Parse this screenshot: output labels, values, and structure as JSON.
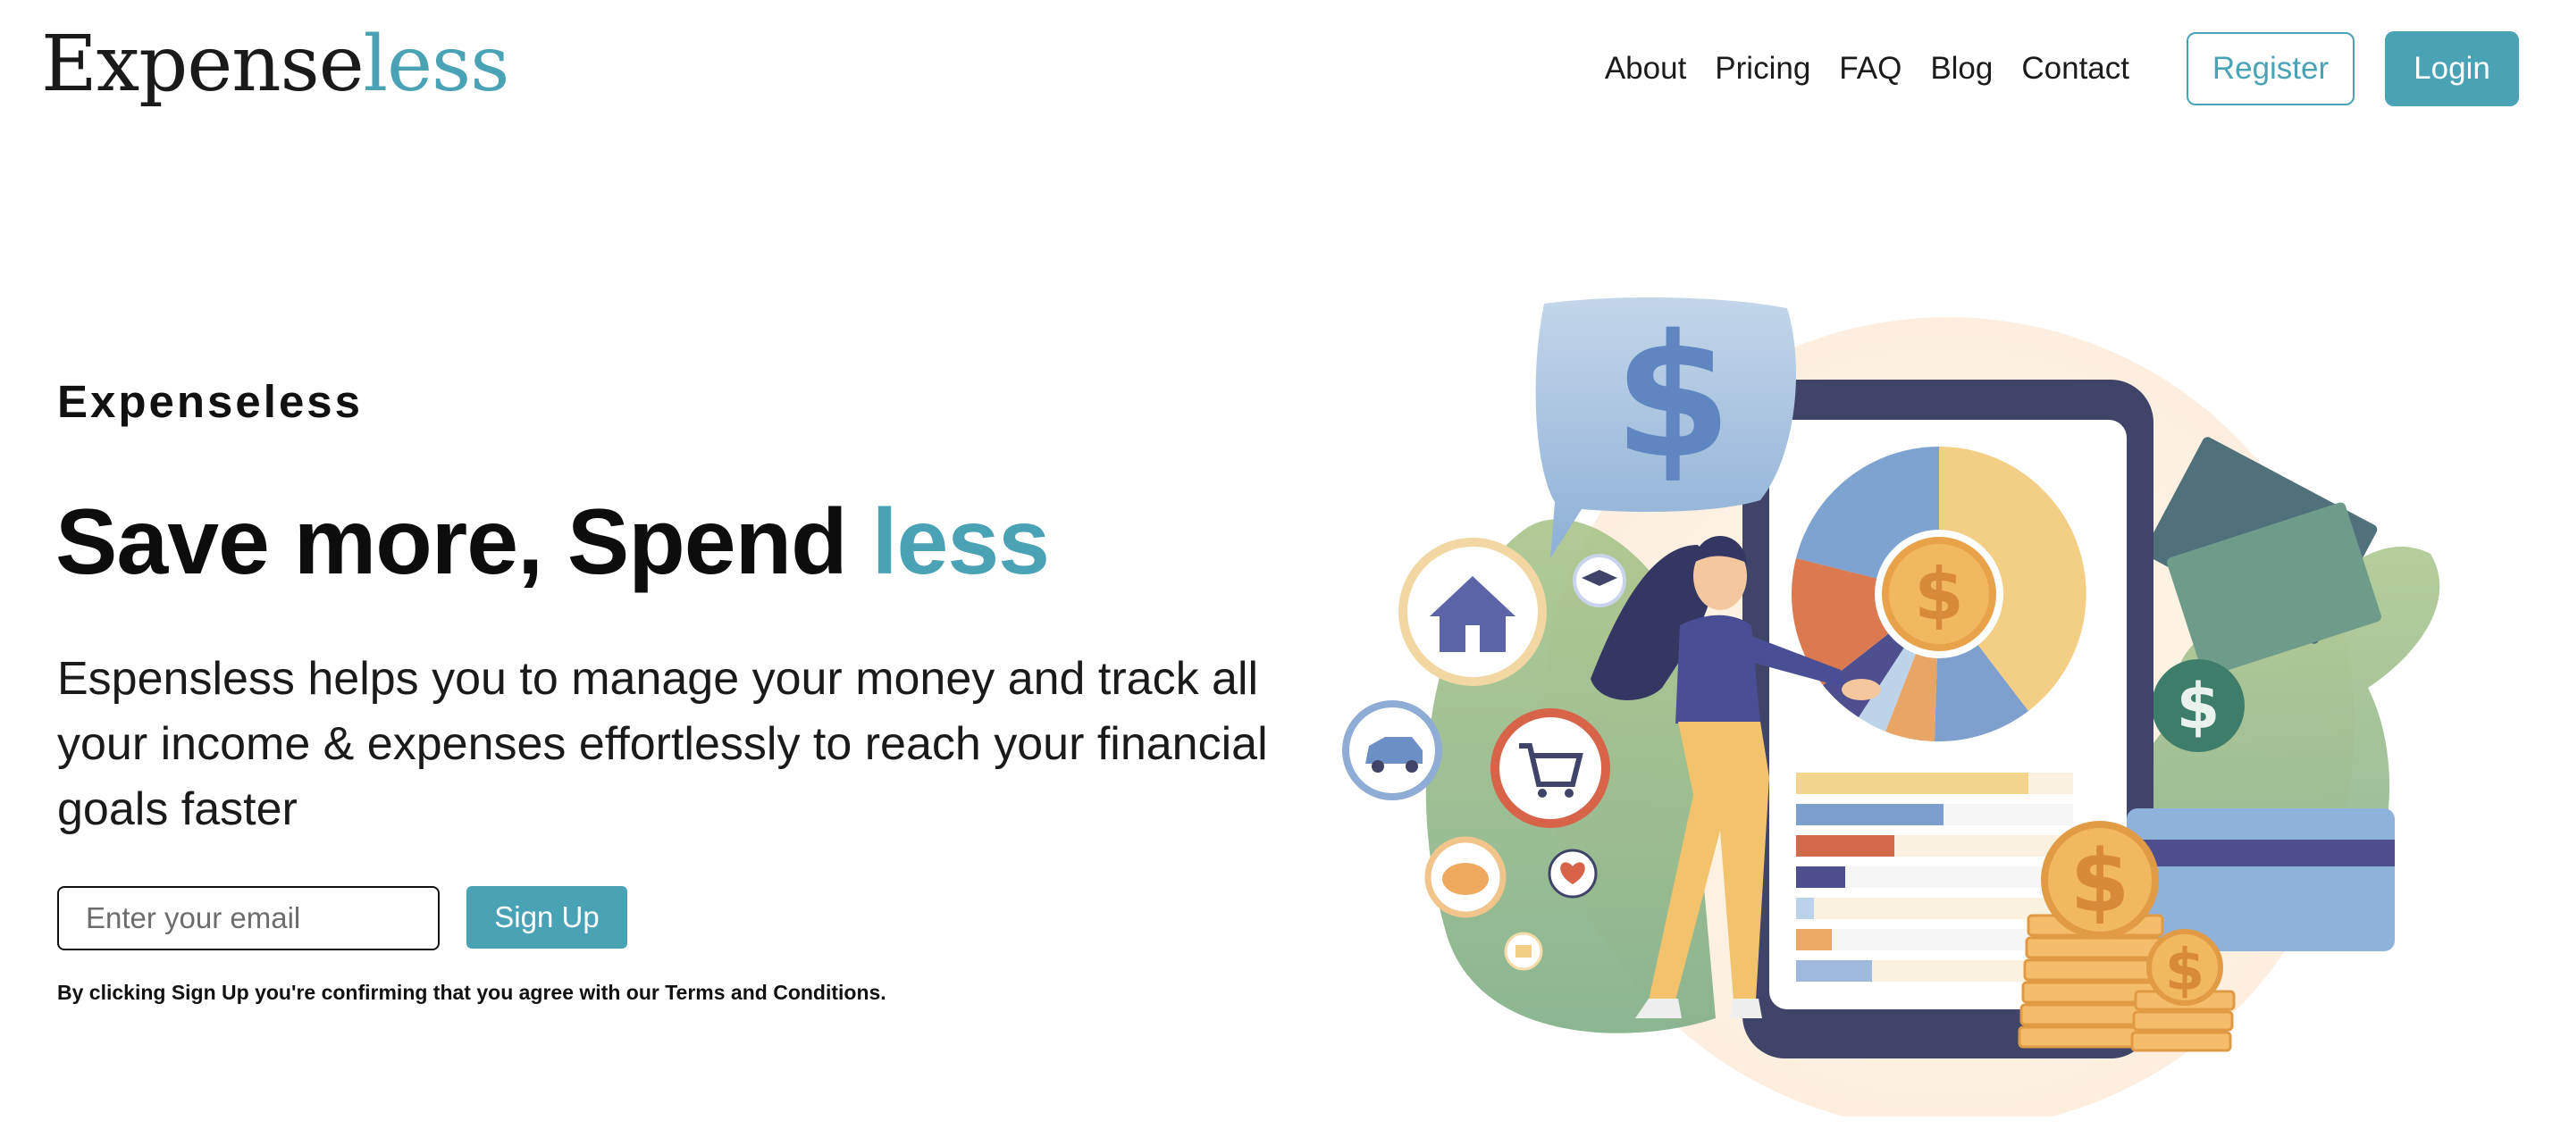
{
  "brand": {
    "name_main": "Expense",
    "name_accent": "less"
  },
  "nav": {
    "links": [
      "About",
      "Pricing",
      "FAQ",
      "Blog",
      "Contact"
    ],
    "register_label": "Register",
    "login_label": "Login"
  },
  "hero": {
    "eyebrow": "Expenseless",
    "headline_main": "Save more, Spend ",
    "headline_accent": "less",
    "description": "Espensless helps you to manage your money and track all your income & expenses effortlessly to reach your financial goals faster",
    "email_placeholder": "Enter your email",
    "signup_label": "Sign Up",
    "terms_text": "By clicking Sign Up you're confirming that you agree with our Terms and Conditions."
  },
  "illustration": {
    "icons": [
      "dollar-speech-bubble-icon",
      "house-icon",
      "graduation-cap-icon",
      "car-icon",
      "shopping-cart-icon",
      "piggy-bank-icon",
      "heart-icon",
      "gift-icon",
      "money-bills-icon",
      "credit-card-icon",
      "coin-stack-icon"
    ]
  },
  "colors": {
    "accent": "#4aa3b5",
    "text": "#111111",
    "background": "#ffffff"
  }
}
